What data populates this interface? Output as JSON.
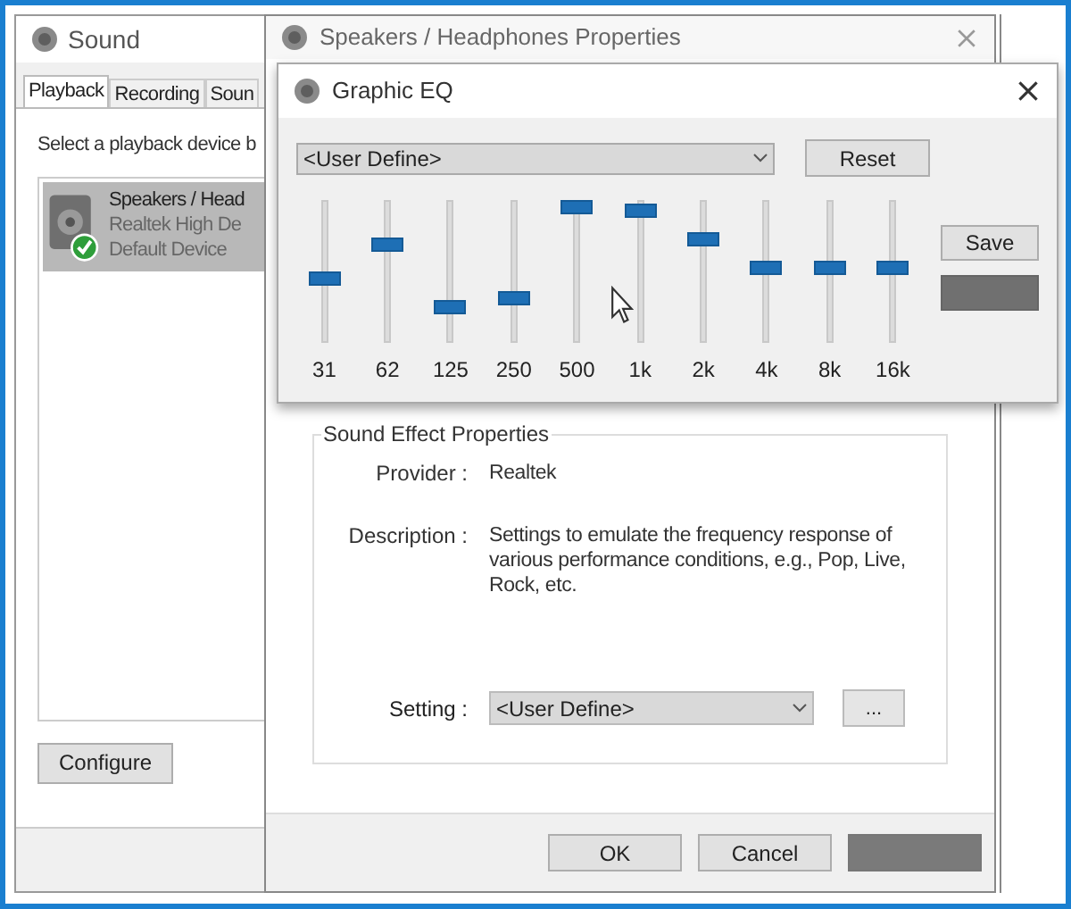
{
  "sound_window": {
    "title": "Sound",
    "tabs": [
      {
        "label": "Playback",
        "selected": true
      },
      {
        "label": "Recording",
        "selected": false
      },
      {
        "label": "Soun",
        "selected": false
      }
    ],
    "instruction": "Select a playback device b",
    "devices": [
      {
        "name": "Speakers / Head",
        "driver": "Realtek High De",
        "status": "Default Device",
        "selected": true,
        "is_default": true
      }
    ],
    "configure_button": "Configure"
  },
  "properties_window": {
    "title": "Speakers / Headphones Properties",
    "group_title": "Sound Effect Properties",
    "fields": [
      {
        "label": "Provider :",
        "value": "Realtek"
      },
      {
        "label": "Description :",
        "value": "Settings to emulate the frequency response of various performance conditions,  e.g., Pop, Live, Rock, etc."
      }
    ],
    "setting": {
      "label": "Setting :",
      "value": "<User Define>",
      "more_button": "..."
    },
    "buttons": [
      {
        "label": "OK",
        "disabled": false
      },
      {
        "label": "Cancel",
        "disabled": false
      },
      {
        "disabled": true
      }
    ]
  },
  "eq_window": {
    "title": "Graphic EQ",
    "preset": "<User Define>",
    "reset_button": "Reset",
    "bands": [
      {
        "label": "31",
        "level": 0.45
      },
      {
        "label": "62",
        "level": 0.71
      },
      {
        "label": "125",
        "level": 0.22
      },
      {
        "label": "250",
        "level": 0.29
      },
      {
        "label": "500",
        "level": 1.0
      },
      {
        "label": "1k",
        "level": 0.97
      },
      {
        "label": "2k",
        "level": 0.75
      },
      {
        "label": "4k",
        "level": 0.53
      },
      {
        "label": "8k",
        "level": 0.53
      },
      {
        "label": "16k",
        "level": 0.53
      }
    ],
    "buttons": [
      {
        "label": "Save",
        "disabled": false
      },
      {
        "disabled": true
      }
    ]
  }
}
